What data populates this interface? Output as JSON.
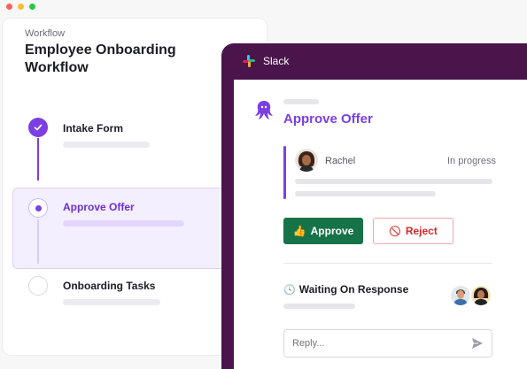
{
  "colors": {
    "brand_purple": "#7b3fe4",
    "slack_aubergine": "#4a154b",
    "approve_green": "#157347",
    "reject_red": "#d42a2a",
    "window_dots": [
      "#ff5f57",
      "#febc2e",
      "#28c840"
    ]
  },
  "workflow": {
    "label": "Workflow",
    "title": "Employee Onboarding Workflow",
    "steps": [
      {
        "label": "Intake Form",
        "status": "completed",
        "icon": "check-icon"
      },
      {
        "label": "Approve Offer",
        "status": "active",
        "icon": "dot-icon"
      },
      {
        "label": "Onboarding Tasks",
        "status": "pending",
        "icon": "empty-circle-icon"
      }
    ]
  },
  "slack": {
    "app_name": "Slack",
    "logo": "slack-logo-icon",
    "message": {
      "bot_icon": "octopus-bot-icon",
      "title": "Approve Offer",
      "requester": {
        "name": "Rachel",
        "status": "In progress"
      },
      "approve_label": "Approve",
      "approve_icon": "👍",
      "reject_label": "Reject",
      "reject_icon": "🚫",
      "waiting_icon": "🕓",
      "waiting_label": "Waiting On Response",
      "reply_placeholder": "Reply...",
      "send_icon": "send-icon"
    }
  }
}
